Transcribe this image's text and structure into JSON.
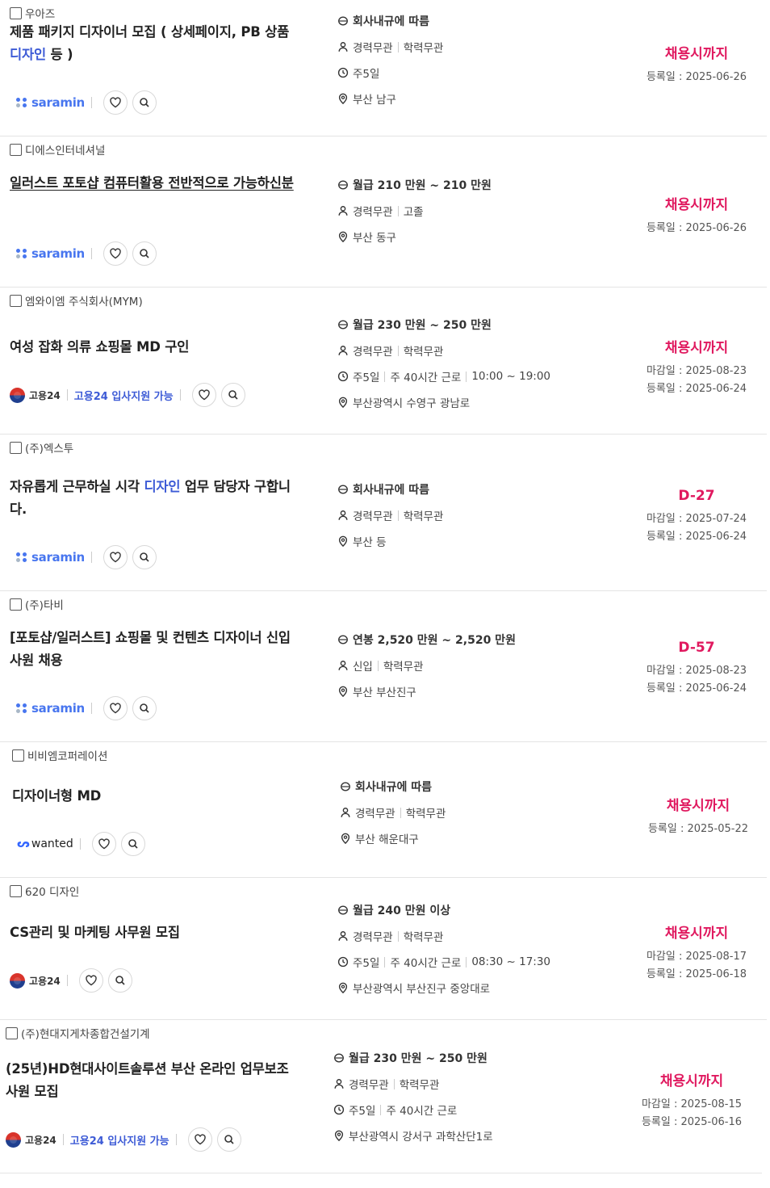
{
  "jobs": [
    {
      "company": "우아즈",
      "title_pre": "제품 패키지 디자이너 모집 ( 상세페이지, PB 상품 ",
      "title_kw": "디자인",
      "title_post": " 등 )",
      "source": "saramin",
      "apply_label": "",
      "salary": "회사내규에 따름",
      "conditions": [
        "경력무관",
        "학력무관"
      ],
      "schedule": [
        "주5일"
      ],
      "location": "부산 남구",
      "deadline": "채용시까지",
      "close_date": "",
      "reg_date": "등록일 : 2025-06-26"
    },
    {
      "company": "디에스인터네셔널",
      "title_pre": "일러스트 포토샵 컴퓨터활용 전반적으로 가능하신분",
      "title_kw": "",
      "title_post": "",
      "source": "saramin",
      "apply_label": "",
      "salary": "월급 210 만원 ~ 210 만원",
      "conditions": [
        "경력무관",
        "고졸"
      ],
      "schedule": [],
      "location": "부산 동구",
      "deadline": "채용시까지",
      "close_date": "",
      "reg_date": "등록일 : 2025-06-26"
    },
    {
      "company": "엠와이엠 주식회사(MYM)",
      "title_pre": "여성 잡화 의류 쇼핑몰 MD 구인",
      "title_kw": "",
      "title_post": "",
      "source": "goyong24",
      "apply_label": "고용24 입사지원 가능",
      "salary": "월급 230 만원 ~ 250 만원",
      "conditions": [
        "경력무관",
        "학력무관"
      ],
      "schedule": [
        "주5일",
        "주 40시간 근로",
        "10:00 ~ 19:00"
      ],
      "location": "부산광역시 수영구 광남로",
      "deadline": "채용시까지",
      "close_date": "마감일 : 2025-08-23",
      "reg_date": "등록일 : 2025-06-24"
    },
    {
      "company": "(주)엑스투",
      "title_pre": "자유롭게 근무하실 시각 ",
      "title_kw": "디자인",
      "title_post": " 업무 담당자 구합니다.",
      "source": "saramin",
      "apply_label": "",
      "salary": "회사내규에 따름",
      "conditions": [
        "경력무관",
        "학력무관"
      ],
      "schedule": [],
      "location": "부산 등",
      "deadline": "D-27",
      "close_date": "마감일 : 2025-07-24",
      "reg_date": "등록일 : 2025-06-24"
    },
    {
      "company": "(주)타비",
      "title_pre": "[포토샵/일러스트] 쇼핑몰 및 컨텐츠 디자이너 신입사원 채용",
      "title_kw": "",
      "title_post": "",
      "source": "saramin",
      "apply_label": "",
      "salary": "연봉 2,520 만원 ~ 2,520 만원",
      "conditions": [
        "신입",
        "학력무관"
      ],
      "schedule": [],
      "location": "부산 부산진구",
      "deadline": "D-57",
      "close_date": "마감일 : 2025-08-23",
      "reg_date": "등록일 : 2025-06-24"
    },
    {
      "company": "비비엠코퍼레이션",
      "title_pre": "디자이너형 MD",
      "title_kw": "",
      "title_post": "",
      "source": "wanted",
      "apply_label": "",
      "salary": "회사내규에 따름",
      "conditions": [
        "경력무관",
        "학력무관"
      ],
      "schedule": [],
      "location": "부산 해운대구",
      "deadline": "채용시까지",
      "close_date": "",
      "reg_date": "등록일 : 2025-05-22"
    },
    {
      "company": "620 디자인",
      "title_pre": "CS관리 및 마케팅 사무원 모집",
      "title_kw": "",
      "title_post": "",
      "source": "goyong24",
      "apply_label": "",
      "salary": "월급 240 만원 이상",
      "conditions": [
        "경력무관",
        "학력무관"
      ],
      "schedule": [
        "주5일",
        "주 40시간 근로",
        "08:30 ~ 17:30"
      ],
      "location": "부산광역시 부산진구 중앙대로",
      "deadline": "채용시까지",
      "close_date": "마감일 : 2025-08-17",
      "reg_date": "등록일 : 2025-06-18"
    },
    {
      "company": "(주)현대지게차종합건설기계",
      "title_pre": "(25년)HD현대사이트솔루션 부산 온라인 업무보조 사원 모집",
      "title_kw": "",
      "title_post": "",
      "source": "goyong24",
      "apply_label": "고용24 입사지원 가능",
      "salary": "월급 230 만원 ~ 250 만원",
      "conditions": [
        "경력무관",
        "학력무관"
      ],
      "schedule": [
        "주5일",
        "주 40시간 근로"
      ],
      "location": "부산광역시 강서구 과학산단1로",
      "deadline": "채용시까지",
      "close_date": "마감일 : 2025-08-15",
      "reg_date": "등록일 : 2025-06-16"
    }
  ],
  "logos": {
    "saramin": "saramin",
    "goyong24": "고용24",
    "wanted": "wanted",
    "wanted_mark": "ᔕ"
  },
  "colors": {
    "deadline": "#e0195f",
    "keyword": "#3d5bd6",
    "saramin": "#4876ef"
  }
}
